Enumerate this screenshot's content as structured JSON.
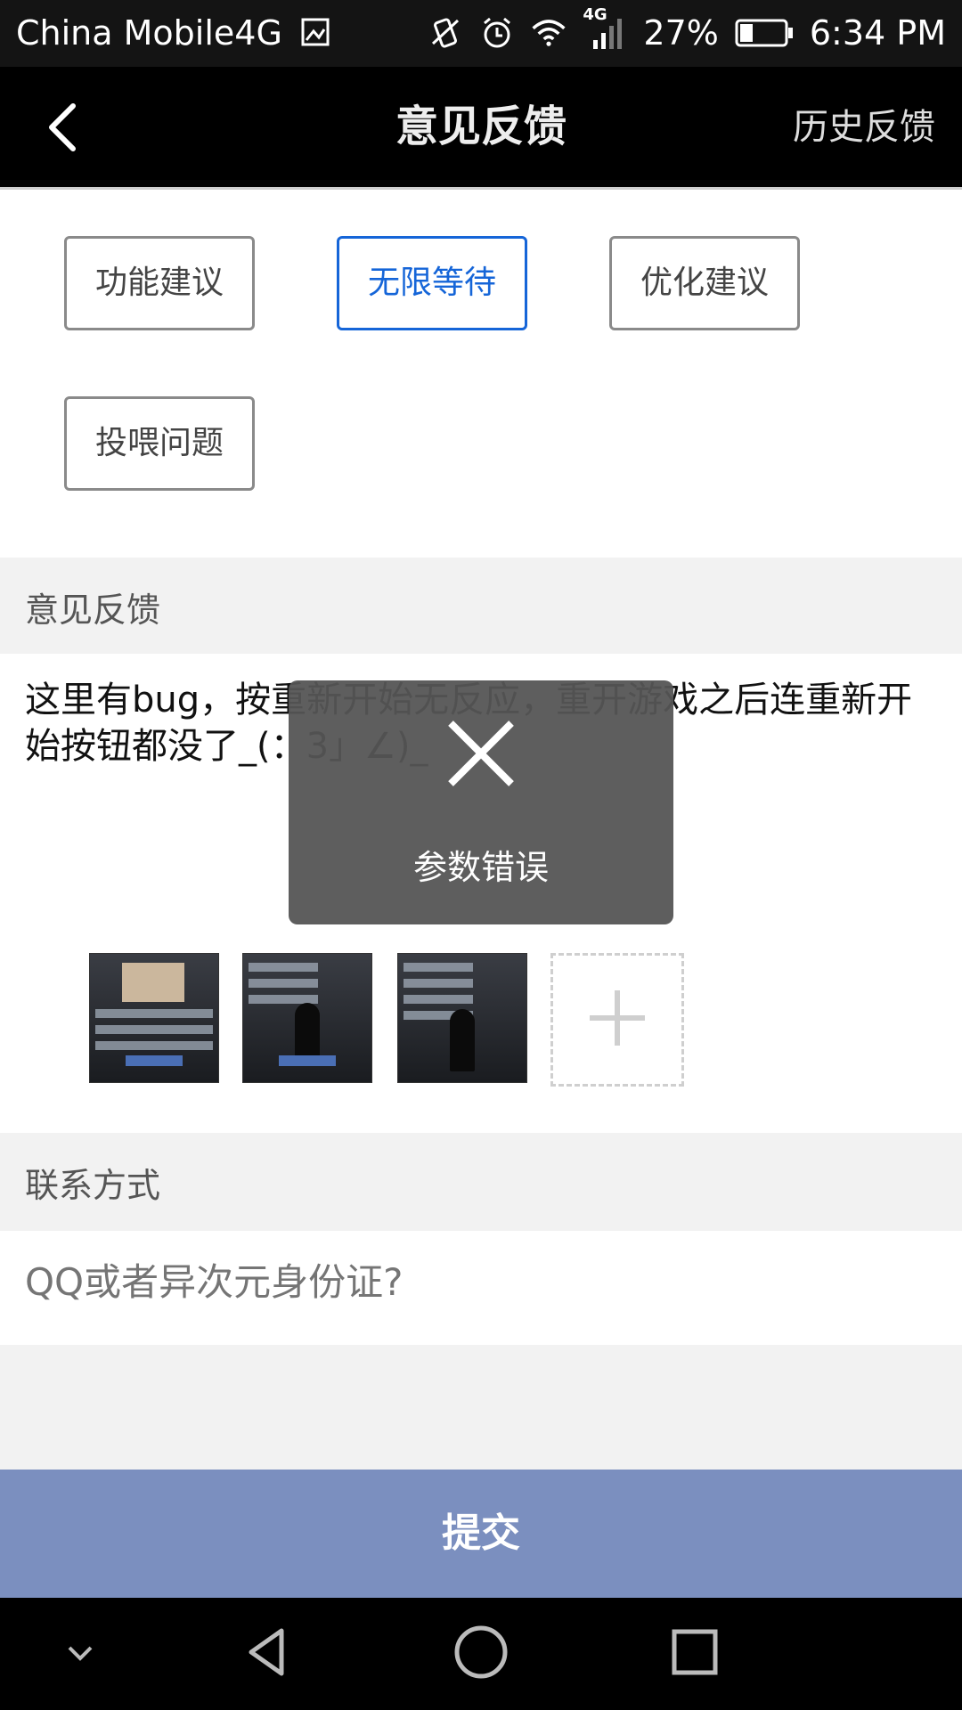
{
  "status_bar": {
    "carrier": "China Mobile4G",
    "network_label": "4G",
    "battery": "27%",
    "time": "6:34 PM"
  },
  "header": {
    "title": "意见反馈",
    "history_label": "历史反馈"
  },
  "categories": [
    {
      "label": "功能建议",
      "selected": false
    },
    {
      "label": "无限等待",
      "selected": true
    },
    {
      "label": "优化建议",
      "selected": false
    },
    {
      "label": "投喂问题",
      "selected": false
    }
  ],
  "feedback": {
    "section_label": "意见反馈",
    "text": "这里有bug，按重新开始无反应，重开游戏之后连重新开始按钮都没了_(：3」∠)_"
  },
  "attachments": {
    "count": 3
  },
  "contact": {
    "section_label": "联系方式",
    "placeholder": "QQ或者异次元身份证?"
  },
  "submit_label": "提交",
  "toast": {
    "message": "参数错误"
  },
  "colors": {
    "accent": "#1565d8",
    "submit_bg": "#7b8fbf",
    "toast_bg": "#555555",
    "section_bg": "#f2f2f2"
  }
}
